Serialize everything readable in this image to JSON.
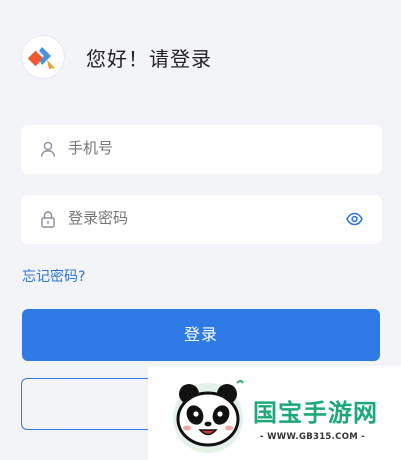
{
  "header": {
    "greeting": "您好！请登录",
    "logo_icon": "app-logo-icon"
  },
  "form": {
    "phone": {
      "placeholder": "手机号",
      "icon": "user-icon"
    },
    "password": {
      "placeholder": "登录密码",
      "lock_icon": "lock-icon",
      "eye_icon": "eye-icon"
    }
  },
  "forgot_label": "忘记密码?",
  "login_label": "登录",
  "watermark": {
    "title": "国宝手游网",
    "url": "- WWW.GB315.COM -"
  },
  "colors": {
    "accent": "#2f7be6",
    "link": "#2f74d8",
    "background": "#f3f4f8",
    "watermark_green": "#1fa77c"
  }
}
